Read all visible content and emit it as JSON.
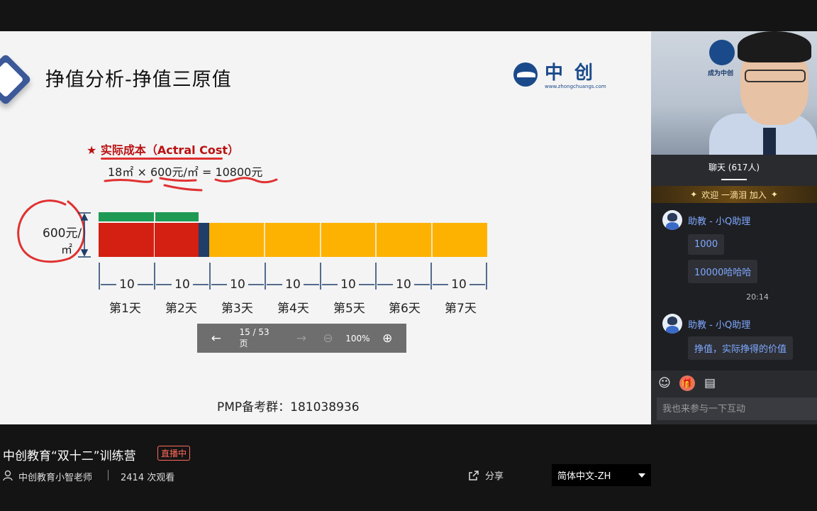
{
  "slide": {
    "title": "挣值分析-挣值三原值",
    "logo_name": "中创",
    "logo_url": "www.zhongchuangs.com",
    "ac_heading": "★ 实际成本（Actral Cost）",
    "formula": "18㎡ × 600元/㎡ = 10800元",
    "axis_label_top": "600元/",
    "axis_label_bottom": "㎡",
    "tens": [
      "10",
      "10",
      "10",
      "10",
      "10",
      "10",
      "10"
    ],
    "days": [
      "第1天",
      "第2天",
      "第3天",
      "第4天",
      "第5天",
      "第6天",
      "第7天"
    ],
    "pmp": "PMP备考群：181038936",
    "colors": {
      "red": "#d32012",
      "green": "#1f9a55",
      "navy": "#1f3f6a",
      "yellow": "#fdb202",
      "annotation": "#e03131"
    }
  },
  "toolbar": {
    "prev_icon": "arrow-left-icon",
    "page": "15 / 53 页",
    "next_icon": "arrow-right-icon",
    "zoom_out_icon": "zoom-out-icon",
    "zoom": "100%",
    "zoom_in_icon": "zoom-in-icon"
  },
  "camera": {
    "logo_text": "成为中创"
  },
  "chat": {
    "tab_label": "聊天 (617人)",
    "welcome": "欢迎  一滴泪  加入",
    "messages": [
      {
        "name": "助教 - 小Q助理",
        "bubbles": [
          "1000",
          "10000哈哈哈"
        ]
      },
      {
        "name": "助教 - 小Q助理",
        "bubbles": [
          "挣值，实际挣得的价值"
        ]
      }
    ],
    "time": "20:14",
    "input_placeholder": "我也来参与一下互动",
    "tools": [
      "emoji-icon",
      "gift-icon",
      "notes-icon"
    ]
  },
  "footer": {
    "stream_title": "中创教育“双十二”训练营",
    "live_badge": "直播中",
    "host": "中创教育小智老师",
    "views": "2414 次观看",
    "share": "分享",
    "language": "简体中文-ZH"
  }
}
